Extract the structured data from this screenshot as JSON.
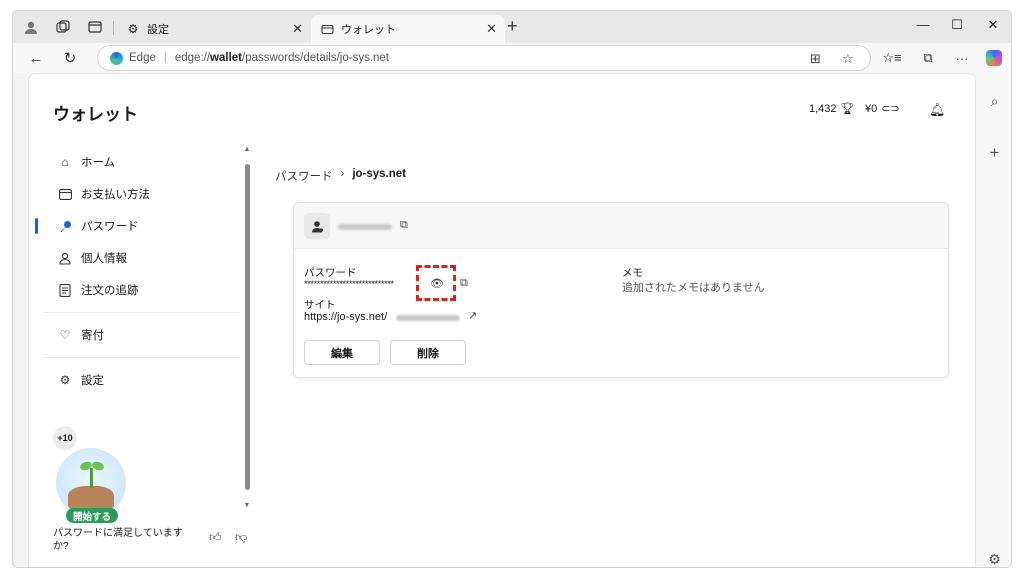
{
  "browser": {
    "tabs": [
      {
        "label": "設定"
      },
      {
        "label": "ウォレット"
      }
    ],
    "address": {
      "site_label": "Edge",
      "url_prefix": "edge://",
      "url_domain": "wallet",
      "url_path": "/passwords/details/jo-sys.net"
    }
  },
  "wallet": {
    "title": "ウォレット",
    "points": "1,432",
    "balance": "¥0"
  },
  "sidebar": {
    "items": [
      {
        "label": "ホーム",
        "icon": "home-icon"
      },
      {
        "label": "お支払い方法",
        "icon": "card-icon"
      },
      {
        "label": "パスワード",
        "icon": "key-icon",
        "active": true
      },
      {
        "label": "個人情報",
        "icon": "person-icon"
      },
      {
        "label": "注文の追跡",
        "icon": "receipt-icon"
      }
    ],
    "donate": "寄付",
    "settings": "設定",
    "badge": "+10",
    "start_button": "開始する",
    "feedback_question": "パスワードに満足していますか?"
  },
  "breadcrumb": {
    "root": "パスワード",
    "current": "jo-sys.net"
  },
  "detail": {
    "password_label": "パスワード",
    "password_value": "****************************",
    "site_label": "サイト",
    "site_value": "https://jo-sys.net/",
    "memo_label": "メモ",
    "memo_value": "追加されたメモはありません",
    "edit_button": "編集",
    "delete_button": "削除"
  }
}
